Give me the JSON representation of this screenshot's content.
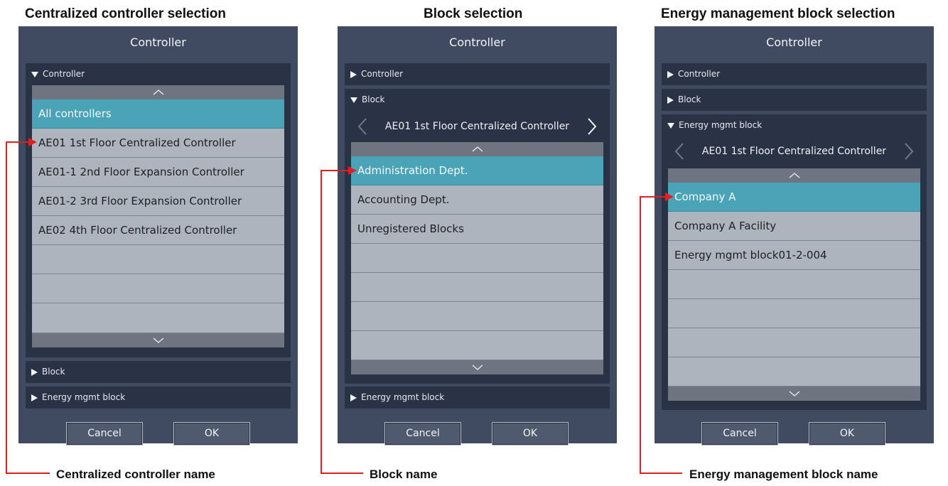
{
  "captions": {
    "panel1": "Centralized controller selection",
    "panel2": "Block selection",
    "panel3": "Energy management block selection"
  },
  "callouts": {
    "panel1": "Centralized controller name",
    "panel2": "Block name",
    "panel3": "Energy management block name"
  },
  "panel1": {
    "title": "Controller",
    "section_controller": "Controller",
    "section_block": "Block",
    "section_energy": "Energy mgmt block",
    "items": [
      "All controllers",
      "AE01 1st Floor Centralized Controller",
      "AE01-1 2nd Floor Expansion Controller",
      "AE01-2 3rd Floor Expansion Controller",
      "AE02 4th Floor Centralized Controller",
      "",
      "",
      ""
    ],
    "selected_index": 0,
    "cancel": "Cancel",
    "ok": "OK"
  },
  "panel2": {
    "title": "Controller",
    "section_controller": "Controller",
    "section_block": "Block",
    "section_energy": "Energy mgmt block",
    "controller_name": "AE01 1st Floor Centralized Controller",
    "items": [
      "Administration Dept.",
      "Accounting Dept.",
      "Unregistered Blocks",
      "",
      "",
      "",
      ""
    ],
    "selected_index": 0,
    "cancel": "Cancel",
    "ok": "OK"
  },
  "panel3": {
    "title": "Controller",
    "section_controller": "Controller",
    "section_block": "Block",
    "section_energy": "Energy mgmt block",
    "controller_name": "AE01 1st Floor Centralized Controller",
    "items": [
      "Company A",
      "Company A Facility",
      "Energy mgmt block01-2-004",
      "",
      "",
      "",
      ""
    ],
    "selected_index": 0,
    "cancel": "Cancel",
    "ok": "OK"
  },
  "colors": {
    "panel_bg": "#404a60",
    "section_bg": "#2a3346",
    "list_bg": "#aeb4be",
    "selected_row": "#4aa3b6",
    "leader_line": "#e02020"
  },
  "icons": {
    "expanded": "triangle-down-icon",
    "collapsed": "triangle-right-icon",
    "scroll_up": "chevron-up-icon",
    "scroll_down": "chevron-down-icon",
    "prev": "chevron-left-icon",
    "next": "chevron-right-icon"
  }
}
